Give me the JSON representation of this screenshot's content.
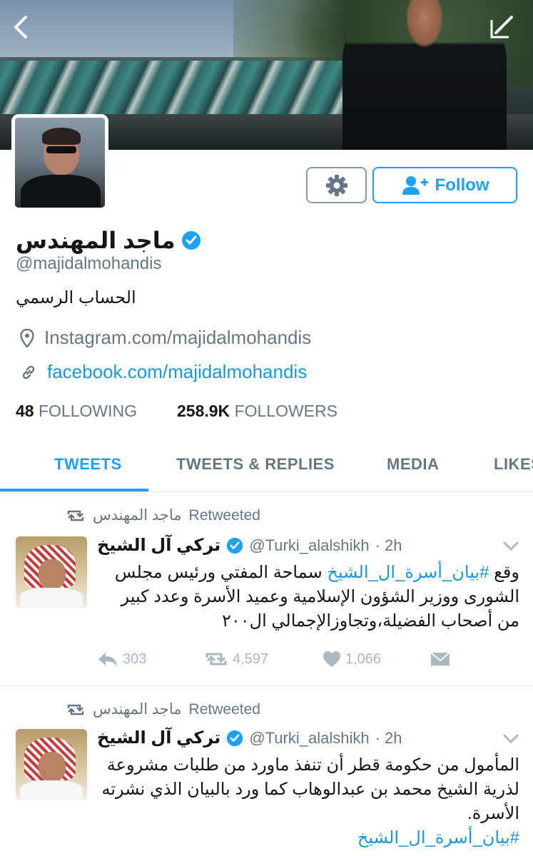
{
  "profile": {
    "name": "ماجد المهندس",
    "handle": "@majidalmohandis",
    "bio": "الحساب الرسمي",
    "location": "Instagram.com/majidalmohandis",
    "website": "facebook.com/majidalmohandis",
    "following_count": "48",
    "following_label": "FOLLOWING",
    "followers_count": "258.9K",
    "followers_label": "FOLLOWERS",
    "verified_icon": "verified-badge-icon"
  },
  "actions": {
    "follow_label": "Follow",
    "settings_icon": "gear-icon"
  },
  "tabs": [
    {
      "label": "TWEETS",
      "active": true
    },
    {
      "label": "TWEETS & REPLIES",
      "active": false
    },
    {
      "label": "MEDIA",
      "active": false
    },
    {
      "label": "LIKES",
      "active": false
    }
  ],
  "tweets": [
    {
      "retweeted_by": "ماجد المهندس",
      "retweeted_label": "Retweeted",
      "author_name": "تركي آل الشيخ",
      "author_handle": "@Turki_alalshikh",
      "time": "· 2h",
      "text_prefix": "وقع ",
      "hashtag": "#بيان_أسرة_ال_الشيخ",
      "text_rest": " سماحة المفتي ورئيس مجلس الشورى ووزير الشؤون الإسلامية وعميد الأسرة وعدد كبير من أصحاب الفضيلة،وتجاوزالإجمالي ال٢٠٠",
      "replies": "303",
      "retweets": "4,597",
      "likes": "1,066"
    },
    {
      "retweeted_by": "ماجد المهندس",
      "retweeted_label": "Retweeted",
      "author_name": "تركي آل الشيخ",
      "author_handle": "@Turki_alalshikh",
      "time": "· 2h",
      "text": "المأمول من حكومة قطر أن تنفذ ماورد من طلبات مشروعة لذرية الشيخ محمد بن عبدالوهاب كما ورد بالبيان الذي نشرته الأسرة.",
      "hashtag": "#بيان_أسرة_ال_الشيخ"
    }
  ],
  "colors": {
    "accent": "#1da1f2",
    "link": "#1b95e0",
    "muted": "#657786",
    "text": "#14171a"
  }
}
